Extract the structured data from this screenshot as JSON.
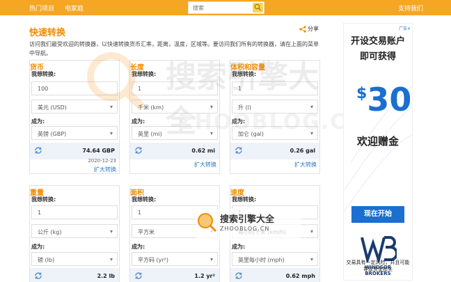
{
  "topbar": {
    "nav_hot": "热门项目",
    "nav_home": "电家庭",
    "search_placeholder": "搜索",
    "support": "支持我们"
  },
  "page": {
    "title": "快速转换",
    "share": "分享",
    "description": "访问我们最受欢迎的转换器，以快速转换货币汇率，距离，温度，区域等。要访问我们所有的转换器，请在上面的菜单中导航。"
  },
  "converters": [
    {
      "title": "货币",
      "want_label": "我想转换:",
      "value": "100",
      "from_unit": "美元 (USD)",
      "to_label": "成为:",
      "to_unit": "英镑 (GBP)",
      "result": "74.64 GBP",
      "date": "2020-12-23",
      "expand": "扩大转换"
    },
    {
      "title": "长度",
      "want_label": "我想转换:",
      "value": "1",
      "from_unit": "千米 (km)",
      "to_label": "成为:",
      "to_unit": "英里 (mi)",
      "result": "0.62 mi",
      "date": "",
      "expand": "扩大转换"
    },
    {
      "title": "体积和容量",
      "want_label": "我想转换:",
      "value": "1",
      "from_unit": "升 (l)",
      "to_label": "成为:",
      "to_unit": "加仑 (gal)",
      "result": "0.26 gal",
      "date": "",
      "expand": "扩大转换"
    },
    {
      "title": "重量",
      "want_label": "我想转换:",
      "value": "1",
      "from_unit": "公斤 (kg)",
      "to_label": "成为:",
      "to_unit": "磅 (lb)",
      "result": "2.2 lb",
      "date": "",
      "expand": ""
    },
    {
      "title": "面积",
      "want_label": "我想转换:",
      "value": "1",
      "from_unit": "平方米",
      "to_label": "成为:",
      "to_unit": "平方码 (yr²)",
      "result": "1.2 yr²",
      "date": "",
      "expand": ""
    },
    {
      "title": "速度",
      "want_label": "我想转换:",
      "value": "1",
      "from_unit": "每小时千米 (km/h)",
      "to_label": "成为:",
      "to_unit": "英里每小时 (mph)",
      "result": "0.62 mph",
      "date": "",
      "expand": ""
    }
  ],
  "ad": {
    "tag": "广告✕",
    "line1": "开设交易账户",
    "line2": "即可获得",
    "amount_symbol": "$",
    "amount": "30",
    "line3": "欢迎赠金",
    "cta": "现在开始",
    "brand1": "WINDSOR",
    "brand2": "BROKERS",
    "risk": "交易具有一定风险，并且可能导致资金损失"
  },
  "watermark": {
    "main": "搜索引擎大全",
    "sub": "ZHOOBLOG.CN"
  },
  "colors": {
    "topbar": "#f5a623",
    "accent": "#f08c00",
    "link": "#2a7ac8",
    "ad_blue": "#1a6fd0",
    "result_bg": "#eef2f9"
  }
}
